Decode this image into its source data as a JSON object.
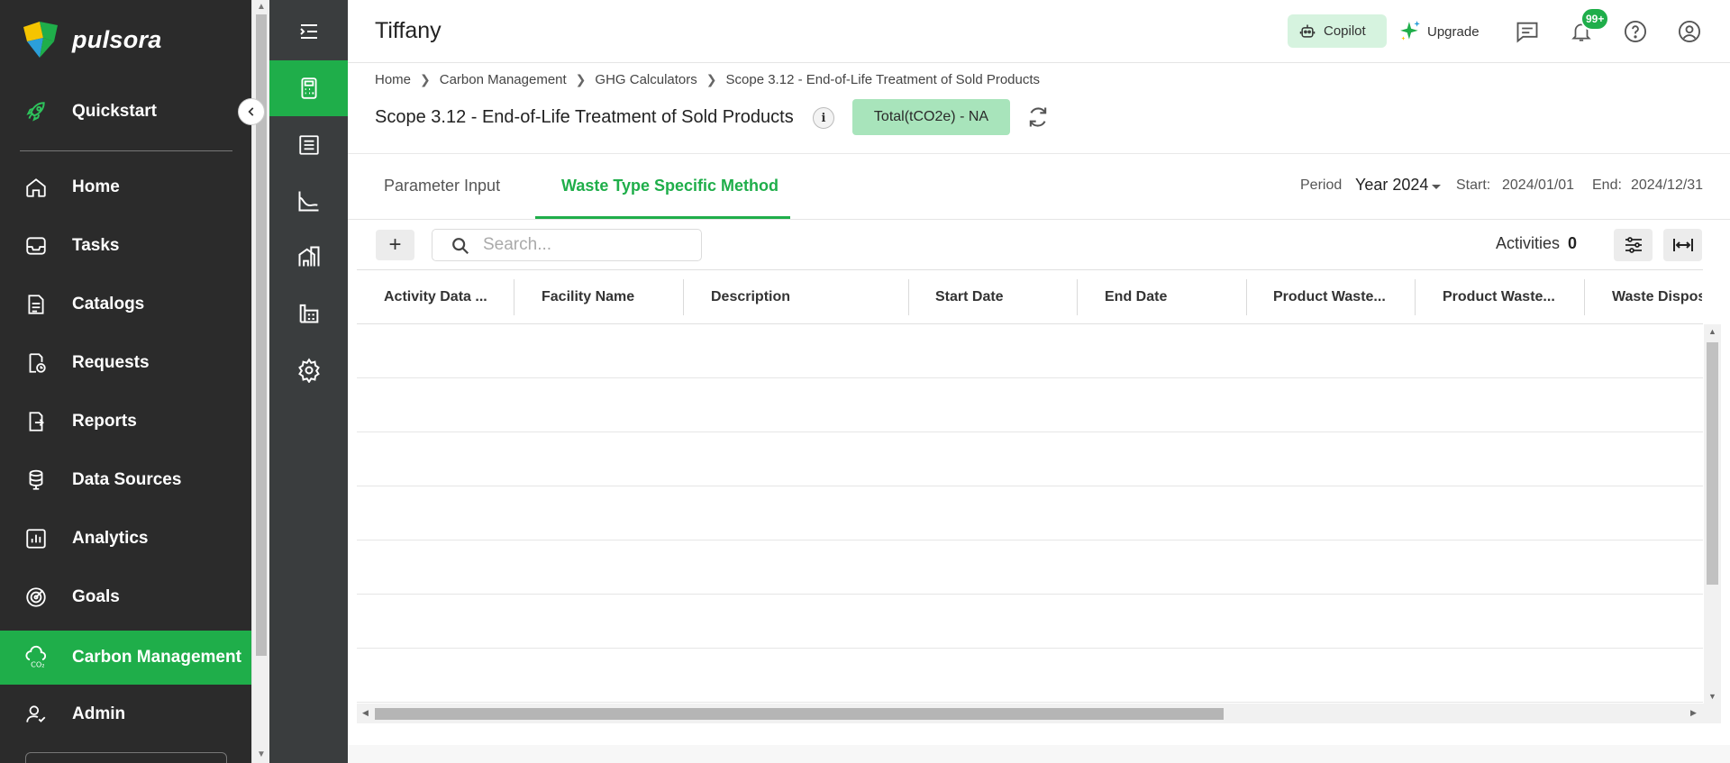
{
  "app": {
    "logo_text": "pulsora",
    "accent": "#1fae4a"
  },
  "sidebar": {
    "items": [
      {
        "label": "Quickstart",
        "icon": "rocket-icon"
      },
      {
        "label": "Home",
        "icon": "home-icon"
      },
      {
        "label": "Tasks",
        "icon": "inbox-icon"
      },
      {
        "label": "Catalogs",
        "icon": "catalog-icon"
      },
      {
        "label": "Requests",
        "icon": "requests-icon"
      },
      {
        "label": "Reports",
        "icon": "reports-icon"
      },
      {
        "label": "Data Sources",
        "icon": "database-icon"
      },
      {
        "label": "Analytics",
        "icon": "analytics-icon"
      },
      {
        "label": "Goals",
        "icon": "goals-icon"
      },
      {
        "label": "Carbon Management",
        "icon": "co2-cloud-icon",
        "active": true
      },
      {
        "label": "Admin",
        "icon": "admin-icon"
      }
    ]
  },
  "rail": {
    "items": [
      {
        "icon": "menu-collapse-icon"
      },
      {
        "icon": "calculator-icon",
        "active": true
      },
      {
        "icon": "ledger-icon"
      },
      {
        "icon": "trend-chart-icon"
      },
      {
        "icon": "buildings-icon"
      },
      {
        "icon": "factory-icon"
      },
      {
        "icon": "settings-gear-icon"
      }
    ]
  },
  "header": {
    "owner": "Tiffany",
    "copilot_label": "Copilot",
    "upgrade_label": "Upgrade",
    "notification_badge": "99+"
  },
  "breadcrumb": [
    "Home",
    "Carbon Management",
    "GHG Calculators",
    "Scope 3.12 - End-of-Life Treatment of Sold Products"
  ],
  "calculator": {
    "title": "Scope 3.12 - End-of-Life Treatment of Sold Products",
    "info_glyph": "i",
    "total_label": "Total(tCO2e) - NA"
  },
  "tabs": [
    {
      "label": "Parameter Input",
      "active": false
    },
    {
      "label": "Waste Type Specific Method",
      "active": true
    }
  ],
  "period": {
    "label": "Period",
    "value": "Year 2024",
    "start_label": "Start:",
    "start_value": "2024/01/01",
    "end_label": "End:",
    "end_value": "2024/12/31"
  },
  "toolbar": {
    "add_label": "+",
    "search_placeholder": "Search...",
    "activities_label": "Activities",
    "activities_count": "0"
  },
  "table": {
    "columns": [
      "Activity Data ...",
      "Facility Name",
      "Description",
      "Start Date",
      "End Date",
      "Product Waste...",
      "Product Waste...",
      "Waste Disposa..."
    ],
    "rows": []
  }
}
